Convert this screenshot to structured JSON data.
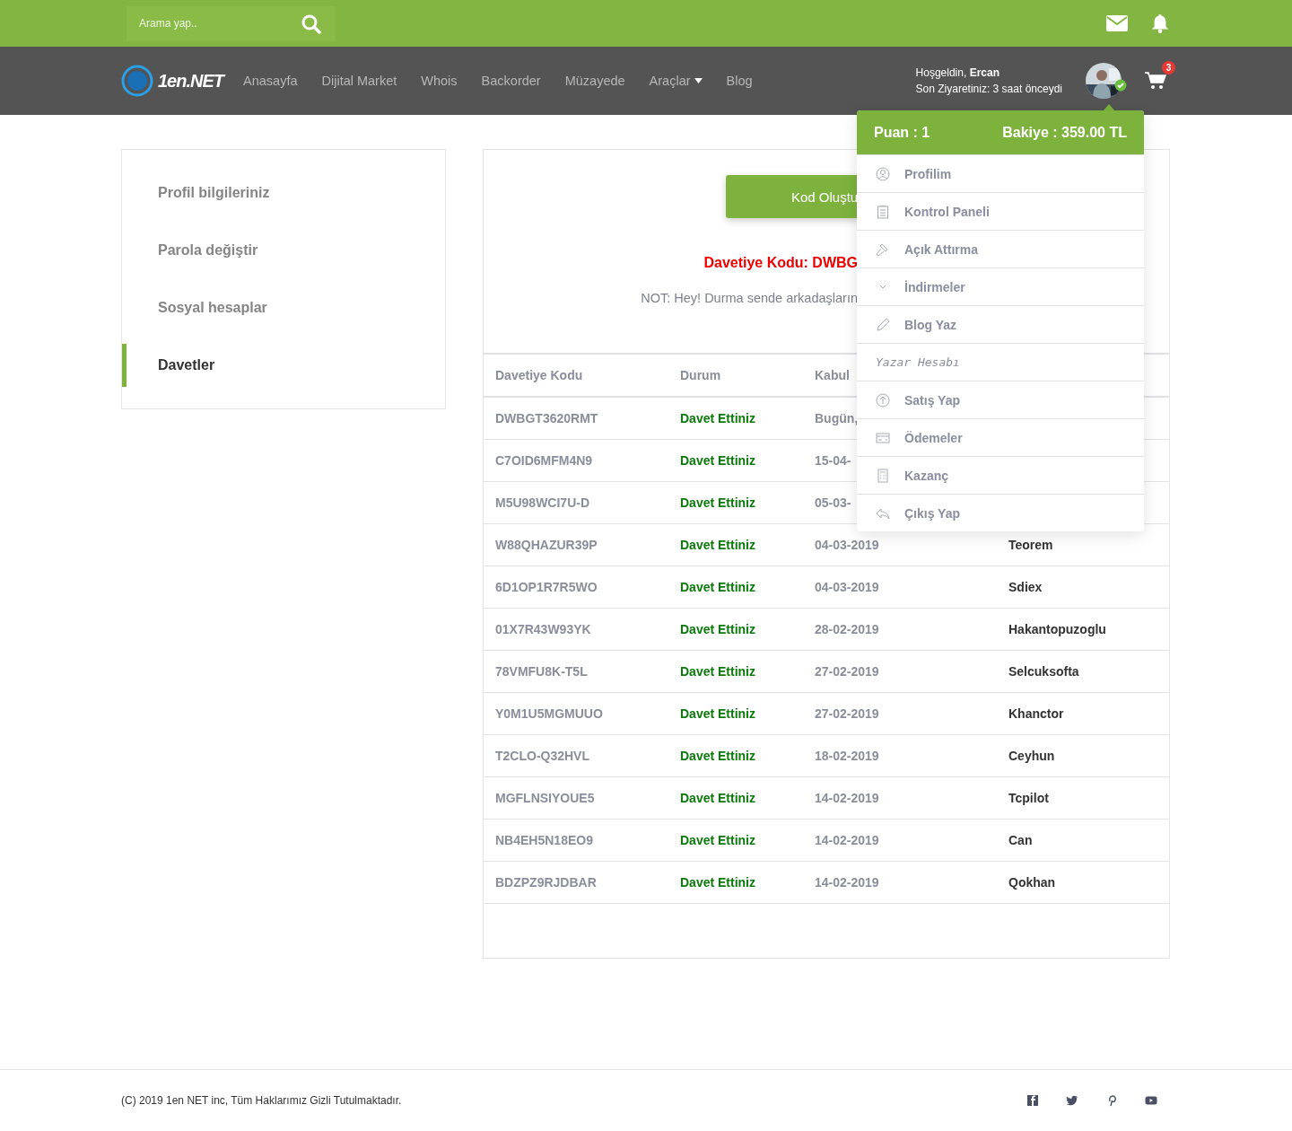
{
  "search": {
    "placeholder": "Arama yap.."
  },
  "logo": {
    "text": "1en.NET"
  },
  "nav": [
    {
      "label": "Anasayfa",
      "has_caret": false
    },
    {
      "label": "Dijital Market",
      "has_caret": false
    },
    {
      "label": "Whois",
      "has_caret": false
    },
    {
      "label": "Backorder",
      "has_caret": false
    },
    {
      "label": "Müzayede",
      "has_caret": false
    },
    {
      "label": "Araçlar",
      "has_caret": true
    },
    {
      "label": "Blog",
      "has_caret": false
    }
  ],
  "user": {
    "greeting": "Hoşgeldin, **Ercan**",
    "last_visit": "Son Ziyaretiniz: 3 saat önceydi",
    "online": true
  },
  "cart": {
    "count": "3"
  },
  "sidebar": {
    "items": [
      {
        "label": "Profil bilgileriniz",
        "selected": false
      },
      {
        "label": "Parola değiştir",
        "selected": false
      },
      {
        "label": "Sosyal hesaplar",
        "selected": false
      },
      {
        "label": "Davetler",
        "selected": true
      }
    ]
  },
  "invite": {
    "button": "Kod Oluştu",
    "code_line": "Davetiye Kodu: DWBG",
    "note": "NOT: Hey! Durma sende arkadaşların"
  },
  "table": {
    "columns": [
      "Davetiye Kodu",
      "Durum",
      "Kabul"
    ],
    "rows": [
      {
        "code": "DWBGT3620RMT",
        "status": "Davet Ettiniz",
        "date": "Bugün,"
      },
      {
        "code": "C7OID6MFM4N9",
        "status": "Davet Ettiniz",
        "date": "15-04-"
      },
      {
        "code": "M5U98WCI7U-D",
        "status": "Davet Ettiniz",
        "date": "05-03-"
      },
      {
        "code": "W88QHAZUR39P",
        "status": "Davet Ettiniz",
        "date": "04-03-2019",
        "user": "Teorem"
      },
      {
        "code": "6D1OP1R7R5WO",
        "status": "Davet Ettiniz",
        "date": "04-03-2019",
        "user": "Sdiex"
      },
      {
        "code": "01X7R43W93YK",
        "status": "Davet Ettiniz",
        "date": "28-02-2019",
        "user": "Hakantopuzoglu"
      },
      {
        "code": "78VMFU8K-T5L",
        "status": "Davet Ettiniz",
        "date": "27-02-2019",
        "user": "Selcuksofta"
      },
      {
        "code": "Y0M1U5MGMUUO",
        "status": "Davet Ettiniz",
        "date": "27-02-2019",
        "user": "Khanctor"
      },
      {
        "code": "T2CLO-Q32HVL",
        "status": "Davet Ettiniz",
        "date": "18-02-2019",
        "user": "Ceyhun"
      },
      {
        "code": "MGFLNSIYOUE5",
        "status": "Davet Ettiniz",
        "date": "14-02-2019",
        "user": "Tcpilot"
      },
      {
        "code": "NB4EH5N18EO9",
        "status": "Davet Ettiniz",
        "date": "14-02-2019",
        "user": "Can"
      },
      {
        "code": "BDZPZ9RJDBAR",
        "status": "Davet Ettiniz",
        "date": "14-02-2019",
        "user": "Qokhan"
      }
    ]
  },
  "dropdown": {
    "points": "Puan : 1",
    "balance": "Bakiye : 359.00 TL",
    "items": [
      {
        "kind": "link",
        "label": "Profilim"
      },
      {
        "kind": "link",
        "label": "Kontrol Paneli"
      },
      {
        "kind": "link",
        "label": "Açık Attırma"
      },
      {
        "kind": "link",
        "label": "İndirmeler"
      },
      {
        "kind": "link",
        "label": "Blog Yaz"
      },
      {
        "kind": "heading",
        "label": "Yazar Hesabı"
      },
      {
        "kind": "link",
        "label": "Satış Yap"
      },
      {
        "kind": "link",
        "label": "Ödemeler"
      },
      {
        "kind": "link",
        "label": "Kazanç"
      },
      {
        "kind": "link",
        "label": "Çıkış Yap"
      }
    ]
  },
  "footer": {
    "copyright": "(C) 2019 1en NET inc, Tüm Haklarımız Gizli Tutulmaktadır."
  }
}
